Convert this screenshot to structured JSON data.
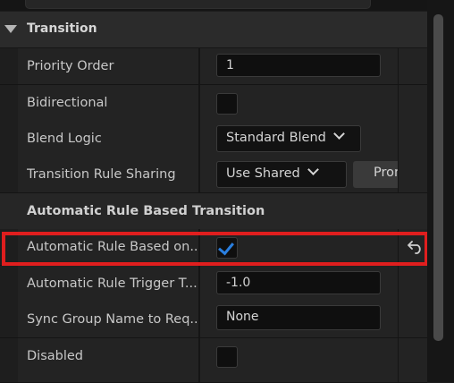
{
  "section": {
    "title": "Transition"
  },
  "rows": {
    "priority_order": {
      "label": "Priority Order",
      "value": "1"
    },
    "bidirectional": {
      "label": "Bidirectional",
      "checked": false
    },
    "blend_logic": {
      "label": "Blend Logic",
      "value": "Standard Blend"
    },
    "transition_rule_sharing": {
      "label": "Transition Rule Sharing",
      "value": "Use Shared",
      "button_label": "Promote"
    },
    "subheader": {
      "label": "Automatic Rule Based Transition"
    },
    "automatic_rule": {
      "label": "Automatic Rule Based on...",
      "checked": true
    },
    "automatic_rule_trigger": {
      "label": "Automatic Rule Trigger T...",
      "value": "-1.0"
    },
    "sync_group": {
      "label": "Sync Group Name to Req...",
      "value": "None"
    },
    "disabled": {
      "label": "Disabled",
      "checked": false
    }
  },
  "icons": {
    "section_caret": "caret-down-icon",
    "dropdown": "chevron-down-icon",
    "reset": "reset-to-default-icon",
    "checkmark": "checkmark-icon"
  },
  "colors": {
    "highlight": "#e01e1e",
    "checkmark": "#2a7fe0",
    "panel_bg": "#232323"
  }
}
